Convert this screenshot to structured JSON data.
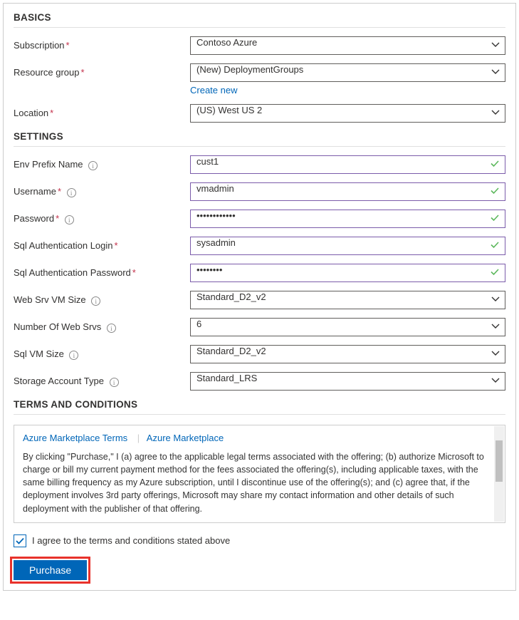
{
  "section_basics": "BASICS",
  "section_settings": "SETTINGS",
  "section_terms": "TERMS AND CONDITIONS",
  "basics": {
    "subscription_label": "Subscription",
    "subscription_value": "Contoso Azure",
    "resource_group_label": "Resource group",
    "resource_group_value": "(New) DeploymentGroups",
    "create_new": "Create new",
    "location_label": "Location",
    "location_value": "(US) West US 2"
  },
  "settings": {
    "env_prefix_label": "Env Prefix Name",
    "env_prefix_value": "cust1",
    "username_label": "Username",
    "username_value": "vmadmin",
    "password_label": "Password",
    "password_value": "••••••••••••",
    "sql_login_label": "Sql Authentication Login",
    "sql_login_value": "sysadmin",
    "sql_password_label": "Sql Authentication Password",
    "sql_password_value": "••••••••",
    "web_vm_size_label": "Web Srv VM Size",
    "web_vm_size_value": "Standard_D2_v2",
    "num_web_srvs_label": "Number Of Web Srvs",
    "num_web_srvs_value": "6",
    "sql_vm_size_label": "Sql VM Size",
    "sql_vm_size_value": "Standard_D2_v2",
    "storage_type_label": "Storage Account Type",
    "storage_type_value": "Standard_LRS"
  },
  "terms": {
    "link1": "Azure Marketplace Terms",
    "link2": "Azure Marketplace",
    "body": "By clicking \"Purchase,\" I (a) agree to the applicable legal terms associated with the offering; (b) authorize Microsoft to charge or bill my current payment method for the fees associated the offering(s), including applicable taxes, with the same billing frequency as my Azure subscription, until I discontinue use of the offering(s); and (c) agree that, if the deployment involves 3rd party offerings, Microsoft may share my contact information and other details of such deployment with the publisher of that offering."
  },
  "agree_label": "I agree to the terms and conditions stated above",
  "purchase_label": "Purchase"
}
